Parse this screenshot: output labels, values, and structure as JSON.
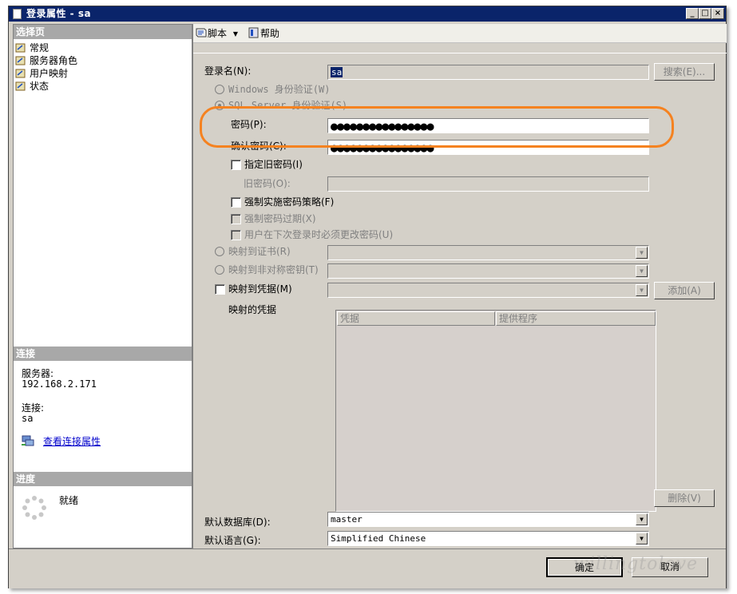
{
  "window": {
    "title": "登录属性 - sa"
  },
  "left": {
    "select_page_header": "选择页",
    "nav_items": [
      "常规",
      "服务器角色",
      "用户映射",
      "状态"
    ],
    "connection_header": "连接",
    "server_label": "服务器:",
    "server_value": "192.168.2.171",
    "connection_label": "连接:",
    "connection_value": "sa",
    "view_connection_link": "查看连接属性",
    "progress_header": "进度",
    "progress_status": "就绪"
  },
  "toolbar": {
    "script_label": "脚本",
    "help_label": "帮助"
  },
  "form": {
    "login_name_label": "登录名(N):",
    "login_name_value": "sa",
    "search_button": "搜索(E)...",
    "windows_auth_label": "Windows 身份验证(W)",
    "sql_auth_label": "SQL Server 身份验证(S)",
    "password_label": "密码(P):",
    "password_value": "●●●●●●●●●●●●●●●●",
    "confirm_password_label": "确认密码(C):",
    "confirm_password_value": "●●●●●●●●●●●●●●●●",
    "specify_old_password_label": "指定旧密码(I)",
    "old_password_label": "旧密码(O):",
    "enforce_policy_label": "强制实施密码策略(F)",
    "enforce_expiration_label": "强制密码过期(X)",
    "must_change_label": "用户在下次登录时必须更改密码(U)",
    "map_cert_label": "映射到证书(R)",
    "map_asym_key_label": "映射到非对称密钥(T)",
    "map_credential_label": "映射到凭据(M)",
    "add_button": "添加(A)",
    "mapped_credentials_label": "映射的凭据",
    "grid_columns": [
      "凭据",
      "提供程序"
    ],
    "remove_button": "删除(V)",
    "default_db_label": "默认数据库(D):",
    "default_db_value": "master",
    "default_lang_label": "默认语言(G):",
    "default_lang_value": "Simplified Chinese"
  },
  "footer": {
    "ok_button": "确定",
    "cancel_button": "取消"
  },
  "watermark": "willingtolove",
  "colors": {
    "titlebar": "#0a246a",
    "highlight_oval": "#f58220",
    "dialog_bg": "#d4d0c8",
    "section_header": "#a8a8a8"
  }
}
